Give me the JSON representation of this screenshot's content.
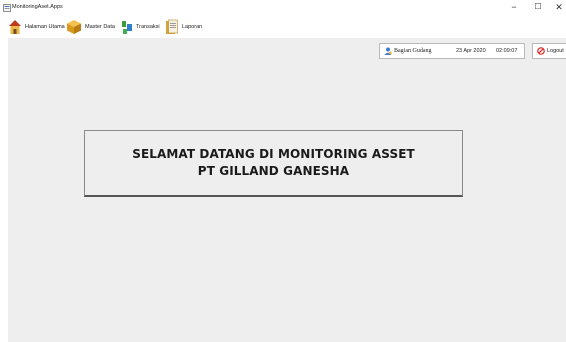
{
  "window": {
    "title": "MonitoringAset.Apps",
    "controls": {
      "minimize": "−",
      "maximize": "☐",
      "close": "✕"
    }
  },
  "menu": {
    "items": [
      {
        "label": "Halaman Utama",
        "icon": "house-icon"
      },
      {
        "label": "Master Data",
        "icon": "box-icon"
      },
      {
        "label": "Transaksi",
        "icon": "transaction-icon"
      },
      {
        "label": "Laporan",
        "icon": "report-icon"
      }
    ]
  },
  "status": {
    "user": "Bagian Gudang",
    "date": "23 Apr 2020",
    "time": "02:09:07",
    "logout": "Logout"
  },
  "welcome": {
    "line1": "SELAMAT DATANG DI MONITORING ASSET",
    "line2": "PT GILLAND GANESHA"
  },
  "colors": {
    "background": "#eeeeee",
    "logout_icon": "#e02020",
    "user_icon": "#3a7bd5"
  }
}
